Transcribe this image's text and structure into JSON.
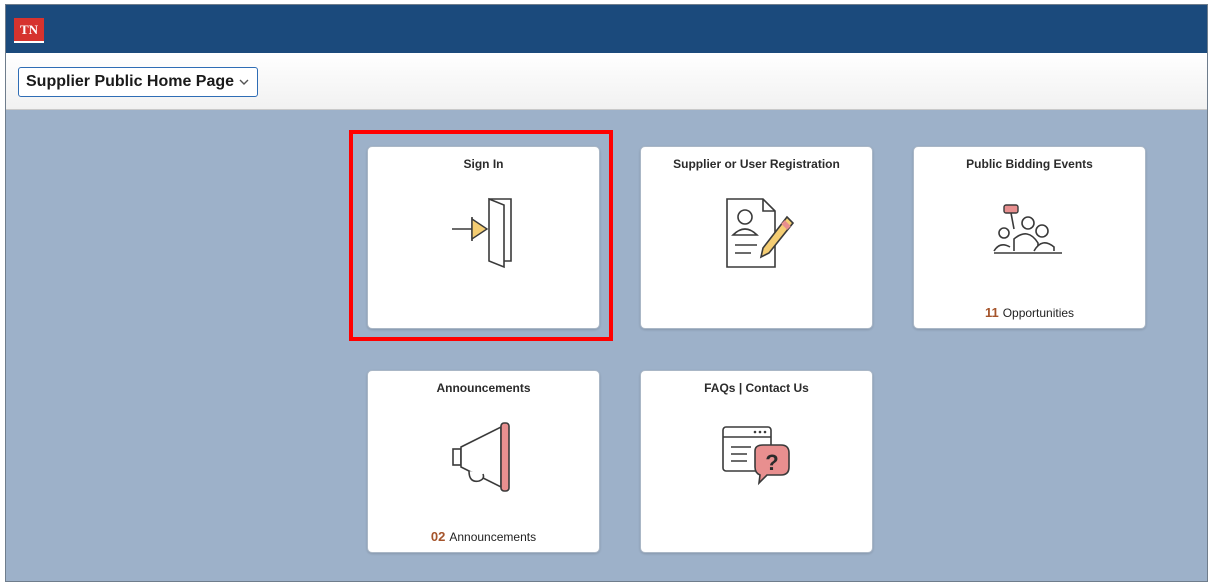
{
  "header": {
    "logo_text": "TN"
  },
  "homepage_selector": {
    "label": "Supplier Public Home Page"
  },
  "tiles": [
    {
      "title": "Sign In",
      "icon": "sign-in-door-icon"
    },
    {
      "title": "Supplier or User Registration",
      "icon": "registration-form-icon"
    },
    {
      "title": "Public Bidding Events",
      "icon": "bidding-auction-icon",
      "count": "11",
      "count_label": "Opportunities"
    },
    {
      "title": "Announcements",
      "icon": "megaphone-icon",
      "count": "02",
      "count_label": "Announcements"
    },
    {
      "title": "FAQs | Contact Us",
      "icon": "faq-help-icon"
    }
  ],
  "colors": {
    "header": "#1b4a7c",
    "background": "#9db1c9",
    "highlight": "#ff0000",
    "count": "#a5542b"
  }
}
